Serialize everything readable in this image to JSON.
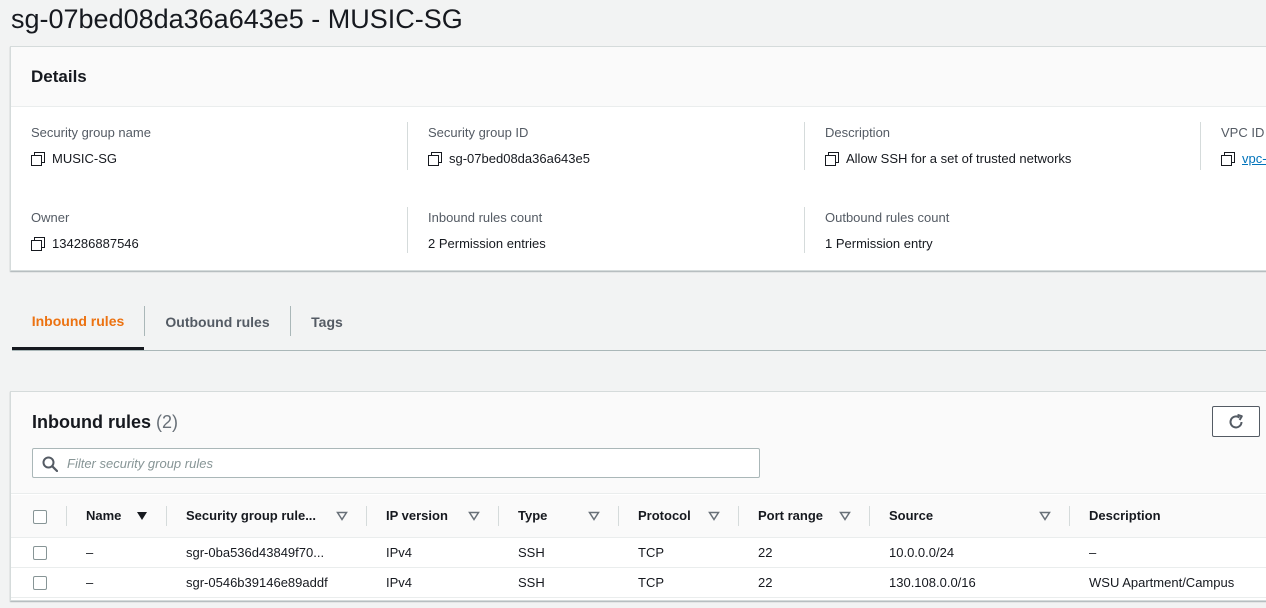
{
  "page": {
    "title": "sg-07bed08da36a643e5 - MUSIC-SG"
  },
  "details": {
    "heading": "Details",
    "fields": [
      {
        "label": "Security group name",
        "value": "MUSIC-SG"
      },
      {
        "label": "Security group ID",
        "value": "sg-07bed08da36a643e5"
      },
      {
        "label": "Description",
        "value": "Allow SSH for a set of trusted networks"
      },
      {
        "label": "VPC ID",
        "value": "vpc-"
      },
      {
        "label": "Owner",
        "value": "134286887546"
      },
      {
        "label": "Inbound rules count",
        "value": "2 Permission entries"
      },
      {
        "label": "Outbound rules count",
        "value": "1 Permission entry"
      }
    ]
  },
  "tabs": [
    {
      "label": "Inbound rules",
      "active": true
    },
    {
      "label": "Outbound rules",
      "active": false
    },
    {
      "label": "Tags",
      "active": false
    }
  ],
  "inbound": {
    "title": "Inbound rules",
    "count": "(2)",
    "search_placeholder": "Filter security group rules",
    "columns": [
      "Name",
      "Security group rule...",
      "IP version",
      "Type",
      "Protocol",
      "Port range",
      "Source",
      "Description"
    ],
    "rows": [
      {
        "name": "–",
        "rule_id": "sgr-0ba536d43849f70...",
        "ip_version": "IPv4",
        "type": "SSH",
        "protocol": "TCP",
        "port_range": "22",
        "source": "10.0.0.0/24",
        "description": "–"
      },
      {
        "name": "–",
        "rule_id": "sgr-0546b39146e89addf",
        "ip_version": "IPv4",
        "type": "SSH",
        "protocol": "TCP",
        "port_range": "22",
        "source": "130.108.0.0/16",
        "description": "WSU Apartment/Campus"
      }
    ]
  },
  "colors": {
    "accent": "#ec7211",
    "link": "#0073bb",
    "text": "#16191f",
    "muted": "#545b64"
  }
}
